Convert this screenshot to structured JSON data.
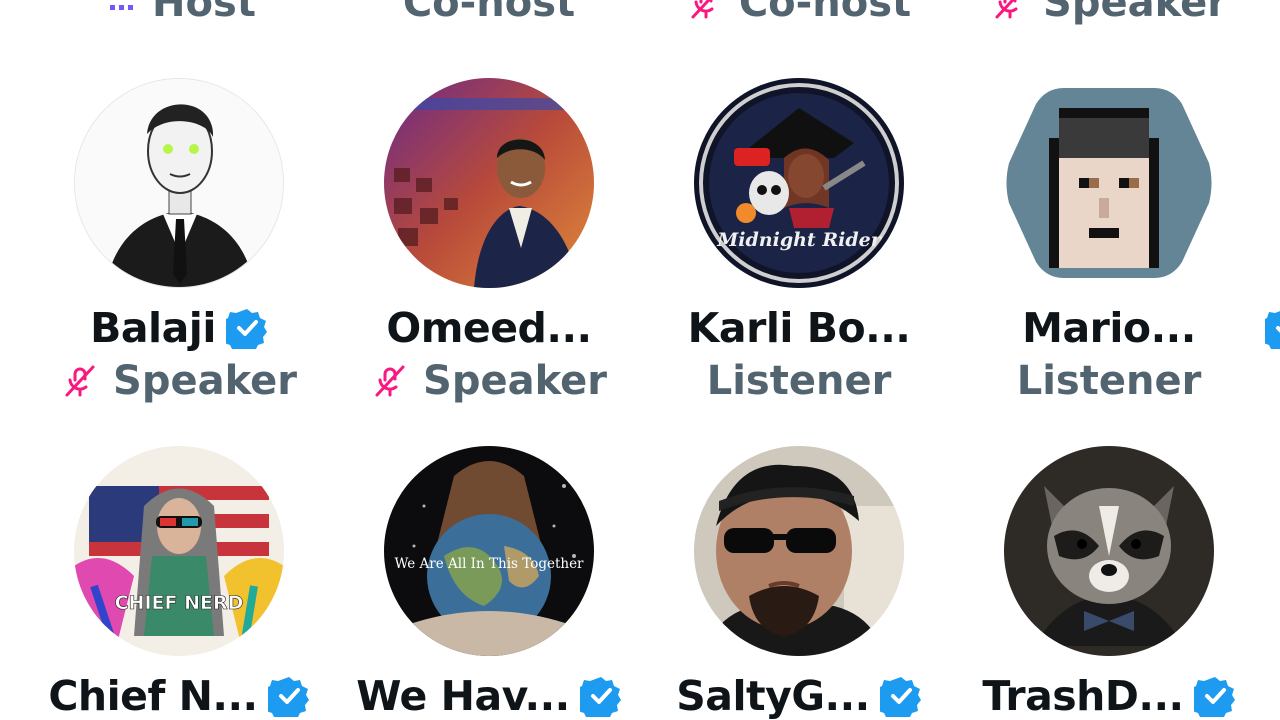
{
  "top_roles": [
    {
      "role": "Host",
      "icon": "host-icon"
    },
    {
      "role": "Co-host",
      "icon": "none"
    },
    {
      "role": "Co-host",
      "icon": "mic-muted-icon"
    },
    {
      "role": "Speaker",
      "icon": "mic-muted-icon"
    }
  ],
  "participants": [
    {
      "name": "Balaji",
      "verified": true,
      "role": "Speaker",
      "muted": true
    },
    {
      "name": "Omeed...",
      "verified": false,
      "role": "Speaker",
      "muted": true
    },
    {
      "name": "Karli Bo...",
      "verified": false,
      "role": "Listener",
      "muted": false
    },
    {
      "name": "Mario...",
      "verified": true,
      "role": "Listener",
      "muted": false
    },
    {
      "name": "Chief N...",
      "verified": true
    },
    {
      "name": "We Hav...",
      "verified": true
    },
    {
      "name": "SaltyG...",
      "verified": true
    },
    {
      "name": "TrashD...",
      "verified": true
    }
  ],
  "avatar_text": {
    "midnight_rider": "Midnight Rider",
    "chief_nerd": "CHIEF NERD",
    "together": "We Are All In This Together"
  },
  "colors": {
    "verified_blue": "#1d9bf0",
    "mic_muted_pink": "#f91880",
    "role_gray": "#536471",
    "name_black": "#0f1419",
    "host_purple": "#7856ff"
  }
}
